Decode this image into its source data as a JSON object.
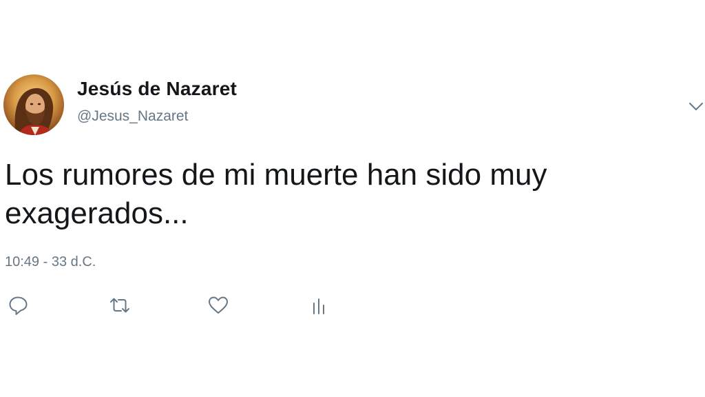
{
  "author": {
    "name": "Jesús de Nazaret",
    "handle": "@Jesus_Nazaret"
  },
  "tweet": {
    "line1": "Los rumores de mi muerte han sido muy",
    "line2": "exagerados..."
  },
  "meta": {
    "time": "10:49",
    "separator": "-",
    "date": "33 d.C."
  },
  "actions": [
    {
      "icon": "reply-icon"
    },
    {
      "icon": "retweet-icon"
    },
    {
      "icon": "like-icon"
    },
    {
      "icon": "analytics-icon"
    }
  ],
  "colors": {
    "text": "#14171a",
    "secondary": "#657786",
    "icon": "#657786",
    "background": "#ffffff"
  }
}
